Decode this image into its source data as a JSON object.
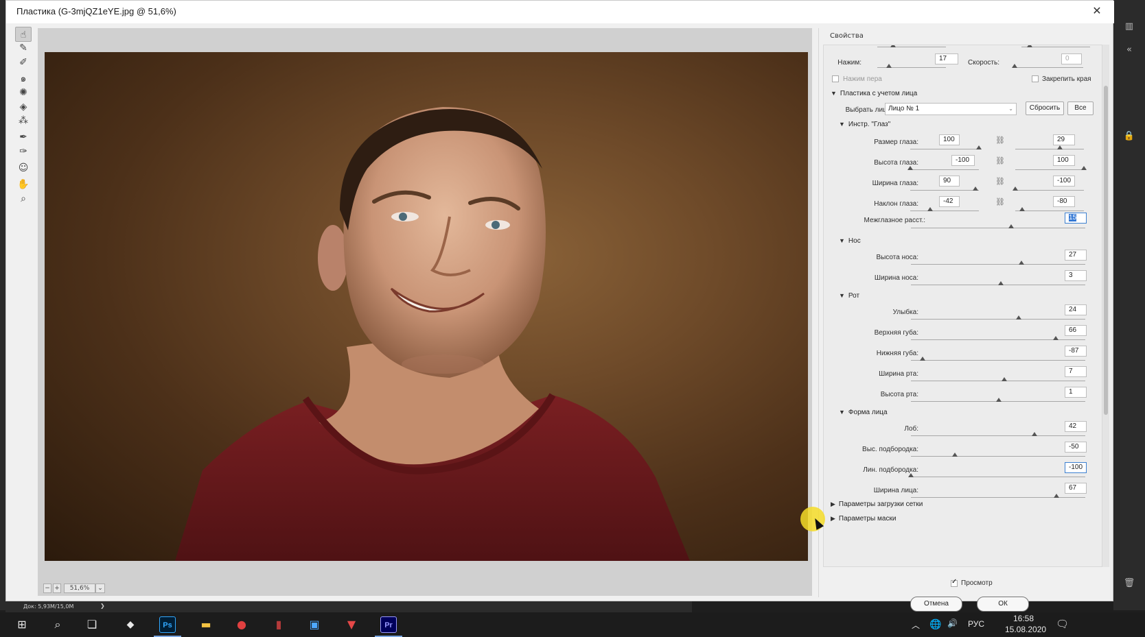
{
  "dialog": {
    "title": "Пластика (G-3mjQZ1eYE.jpg @ 51,6%)",
    "close_glyph": "✕"
  },
  "tools": [
    {
      "name": "forward-warp-tool",
      "icon": "forward-warp-icon",
      "glyph": "☝"
    },
    {
      "name": "reconstruct-tool",
      "icon": "reconstruct-icon",
      "glyph": "✎"
    },
    {
      "name": "smooth-tool",
      "icon": "smooth-icon",
      "glyph": "✐"
    },
    {
      "name": "twirl-tool",
      "icon": "twirl-icon",
      "glyph": "๑"
    },
    {
      "name": "pucker-tool",
      "icon": "pucker-icon",
      "glyph": "✺"
    },
    {
      "name": "bloat-tool",
      "icon": "bloat-icon",
      "glyph": "◈"
    },
    {
      "name": "push-left-tool",
      "icon": "push-left-icon",
      "glyph": "⁂"
    },
    {
      "name": "freeze-mask-tool",
      "icon": "freeze-mask-icon",
      "glyph": "✒"
    },
    {
      "name": "thaw-mask-tool",
      "icon": "thaw-mask-icon",
      "glyph": "✑"
    },
    {
      "name": "face-tool",
      "icon": "face-icon",
      "glyph": "☺"
    },
    {
      "name": "hand-tool",
      "icon": "hand-icon",
      "glyph": "✋"
    },
    {
      "name": "zoom-tool",
      "icon": "zoom-icon",
      "glyph": "⌕"
    }
  ],
  "canvas": {
    "zoom_value": "51,6%"
  },
  "properties": {
    "panel_title": "Свойства",
    "brush": {
      "pressure_label": "Нажим:",
      "pressure_value": "17",
      "pressure_fraction": 0.17,
      "rate_label": "Скорость:",
      "rate_value": "0",
      "rate_fraction": 0.0,
      "pen_pressure_label": "Нажим пера",
      "pin_edges_label": "Закрепить края"
    },
    "face_aware": {
      "header": "Пластика с учетом лица",
      "select_face_label": "Выбрать лицо:",
      "select_face_value": "Лицо № 1",
      "reset_label": "Сбросить",
      "all_label": "Все",
      "eyes": {
        "header": "Инстр. \"Глаз\"",
        "rows": [
          {
            "label": "Размер глаза:",
            "left": "100",
            "right": "29",
            "left_frac": 1.0,
            "right_frac": 0.645
          },
          {
            "label": "Высота глаза:",
            "left": "-100",
            "right": "100",
            "left_frac": 0.0,
            "right_frac": 1.0
          },
          {
            "label": "Ширина глаза:",
            "left": "90",
            "right": "-100",
            "left_frac": 0.95,
            "right_frac": 0.0
          },
          {
            "label": "Наклон глаза:",
            "left": "-42",
            "right": "-80",
            "left_frac": 0.29,
            "right_frac": 0.1
          }
        ],
        "distance_label": "Межглазное расст.:",
        "distance_value": "15",
        "distance_frac": 0.575
      },
      "nose": {
        "header": "Нос",
        "rows": [
          {
            "label": "Высота носа:",
            "value": "27",
            "frac": 0.635
          },
          {
            "label": "Ширина носа:",
            "value": "3",
            "frac": 0.515
          }
        ]
      },
      "mouth": {
        "header": "Рот",
        "rows": [
          {
            "label": "Улыбка:",
            "value": "24",
            "frac": 0.62
          },
          {
            "label": "Верхняя губа:",
            "value": "66",
            "frac": 0.83
          },
          {
            "label": "Нижняя губа:",
            "value": "-87",
            "frac": 0.065
          },
          {
            "label": "Ширина рта:",
            "value": "7",
            "frac": 0.535
          },
          {
            "label": "Высота рта:",
            "value": "1",
            "frac": 0.505
          }
        ]
      },
      "face_shape": {
        "header": "Форма лица",
        "rows": [
          {
            "label": "Лоб:",
            "value": "42",
            "frac": 0.71
          },
          {
            "label": "Выс. подбородка:",
            "value": "-50",
            "frac": 0.25
          },
          {
            "label": "Лин. подбородка:",
            "value": "-100",
            "frac": 0.0
          },
          {
            "label": "Ширина лица:",
            "value": "67",
            "frac": 0.835
          }
        ]
      }
    },
    "mesh_options": "Параметры загрузки сетки",
    "mask_options": "Параметры маски",
    "preview_label": "Просмотр",
    "cancel_label": "Отмена",
    "ok_label": "ОК"
  },
  "status": {
    "doc_info": "Док: 5,93M/15,0M",
    "arrow": "❯"
  },
  "taskbar": {
    "language": "РУС",
    "time": "16:58",
    "date": "15.08.2020",
    "apps": [
      {
        "name": "photoshop",
        "label": "Ps",
        "color": "#31a8ff",
        "bg": "#001e36"
      },
      {
        "name": "premiere",
        "label": "Pr",
        "color": "#9999ff",
        "bg": "#00005b"
      }
    ]
  }
}
